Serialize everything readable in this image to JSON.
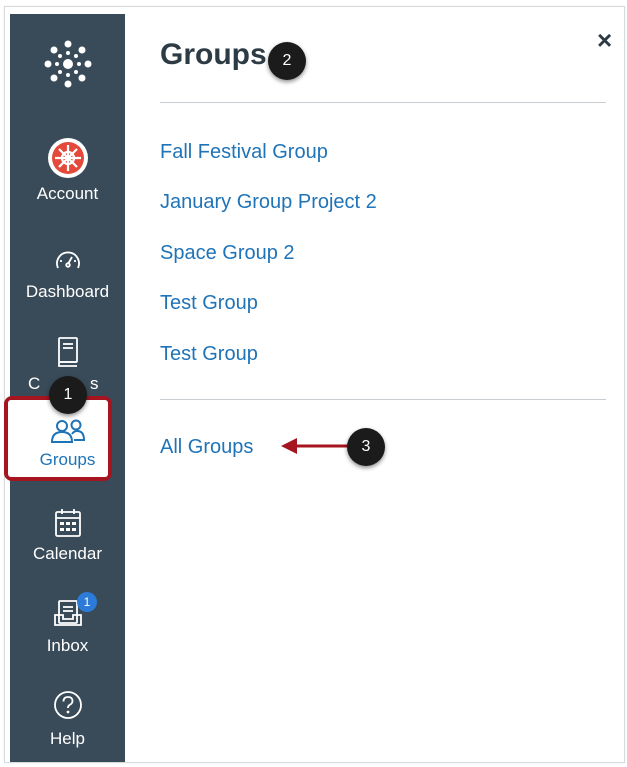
{
  "sidebar": {
    "items": [
      {
        "label": "Account",
        "icon": "account-avatar-icon"
      },
      {
        "label": "Dashboard",
        "icon": "speedometer-icon"
      },
      {
        "label": "Courses",
        "icon": "book-icon"
      },
      {
        "label": "Groups",
        "icon": "users-icon"
      },
      {
        "label": "Calendar",
        "icon": "calendar-icon"
      },
      {
        "label": "Inbox",
        "icon": "inbox-icon",
        "badge": "1"
      },
      {
        "label": "Help",
        "icon": "help-icon"
      }
    ],
    "courses_label_visible_left": "C",
    "courses_label_visible_right": "s"
  },
  "tray": {
    "title": "Groups",
    "close_label": "×",
    "groups": [
      "Fall Festival Group",
      "January Group Project 2",
      "Space Group 2",
      "Test Group",
      "Test Group"
    ],
    "all_groups_label": "All Groups"
  },
  "callouts": {
    "one": "1",
    "two": "2",
    "three": "3"
  },
  "colors": {
    "sidebar_bg": "#394b58",
    "link": "#1f73b7",
    "highlight": "#a5141f",
    "account_red": "#e34a3b",
    "inbox_badge": "#2d7bd8"
  }
}
